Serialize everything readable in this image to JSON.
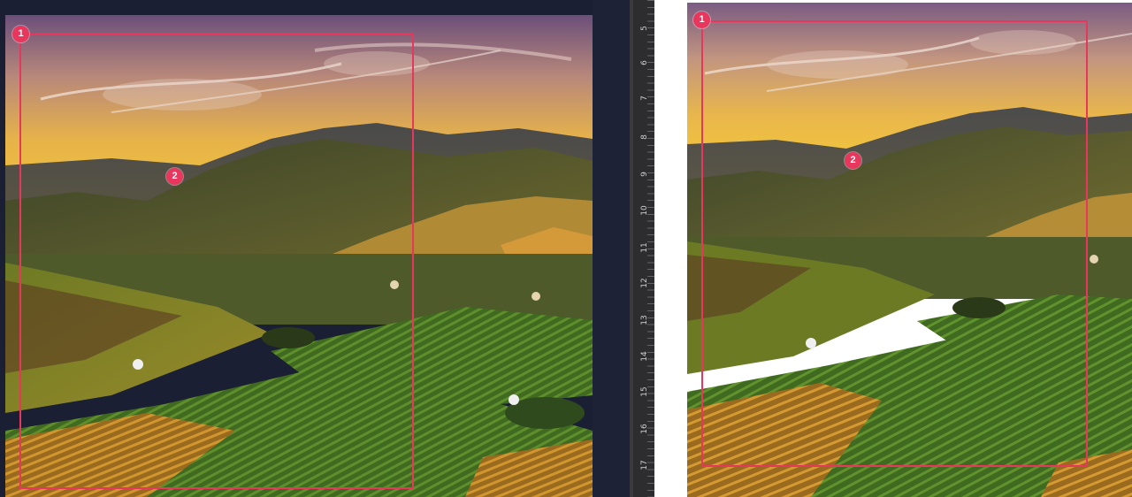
{
  "colors": {
    "accent": "#e8365d",
    "workspace_bg": "#1b1f33",
    "ruler_bg": "#2d2d30",
    "right_canvas_bg": "#ffffff"
  },
  "left_view": {
    "image_label": "vineyard-hills-sunset",
    "markers": [
      {
        "label": "1"
      },
      {
        "label": "2"
      }
    ]
  },
  "ruler": {
    "numbers": [
      "5",
      "6",
      "7",
      "8",
      "9",
      "10",
      "11",
      "12",
      "13",
      "14",
      "15",
      "16",
      "17"
    ]
  },
  "right_view": {
    "image_label": "vineyard-hills-sunset",
    "markers": [
      {
        "label": "1"
      },
      {
        "label": "2"
      }
    ]
  }
}
